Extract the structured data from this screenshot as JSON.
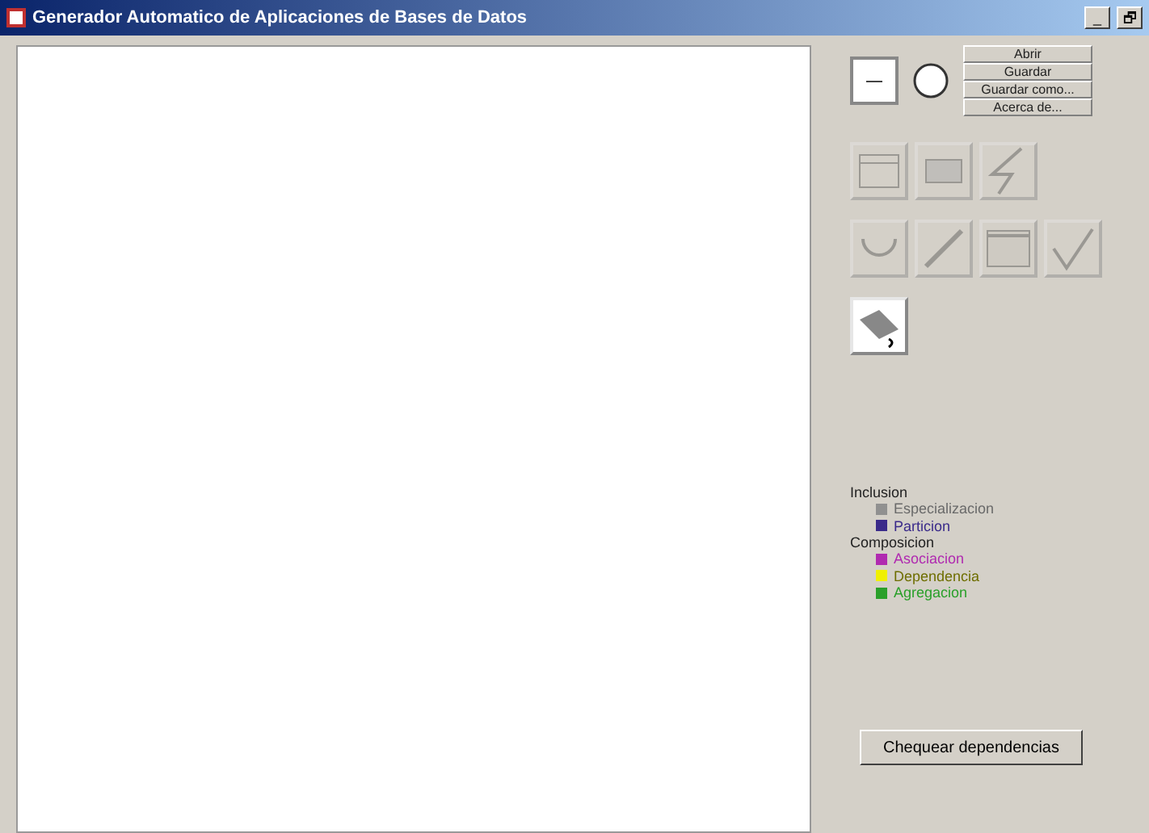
{
  "window": {
    "title": "Generador Automatico de Aplicaciones de Bases de Datos",
    "controls": [
      "_",
      "🗗"
    ]
  },
  "file_buttons": [
    "Abrir",
    "Guardar",
    "Guardar como...",
    "Acerca de..."
  ],
  "tools": [
    {
      "kind": "table",
      "disabled": true
    },
    {
      "kind": "view",
      "disabled": true
    },
    {
      "kind": "bolt",
      "disabled": true
    },
    {
      "kind": "circle",
      "disabled": true
    },
    {
      "kind": "line",
      "disabled": true
    },
    {
      "kind": "bar",
      "disabled": true
    },
    {
      "kind": "check",
      "disabled": true
    },
    {
      "kind": "erase",
      "disabled": false
    }
  ],
  "legend": [
    {
      "kind": "heading",
      "label": "Inclusion"
    },
    {
      "kind": "item",
      "label": "Especializacion",
      "color": "#909090",
      "disabled": true
    },
    {
      "kind": "item",
      "label": "Particion",
      "color": "#3a2a8a",
      "disabled": false
    },
    {
      "kind": "heading",
      "label": "Composicion"
    },
    {
      "kind": "item",
      "label": "Asociacion",
      "color": "#b02ab0",
      "disabled": false
    },
    {
      "kind": "item",
      "label": "Dependencia",
      "color": "#f0f000",
      "disabled": false
    },
    {
      "kind": "item",
      "label": "Agregacion",
      "color": "#2aa02a",
      "disabled": false
    }
  ],
  "check_button": "Chequear dependencias"
}
